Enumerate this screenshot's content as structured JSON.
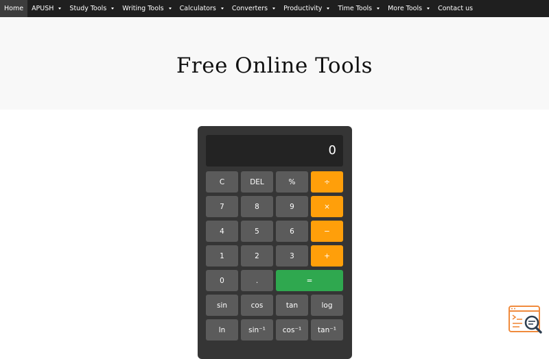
{
  "nav": {
    "items": [
      {
        "label": "Home",
        "dropdown": false,
        "active": true
      },
      {
        "label": "APUSH",
        "dropdown": true
      },
      {
        "label": "Study Tools",
        "dropdown": true
      },
      {
        "label": "Writing Tools",
        "dropdown": true
      },
      {
        "label": "Calculators",
        "dropdown": true
      },
      {
        "label": "Converters",
        "dropdown": true
      },
      {
        "label": "Productivity",
        "dropdown": true
      },
      {
        "label": "Time Tools",
        "dropdown": true
      },
      {
        "label": "More Tools",
        "dropdown": true
      },
      {
        "label": "Contact us",
        "dropdown": false
      }
    ]
  },
  "hero": {
    "title": "Free Online Tools"
  },
  "calculator": {
    "display": "0",
    "keys": {
      "clear": "C",
      "delete": "DEL",
      "percent": "%",
      "divide": "÷",
      "seven": "7",
      "eight": "8",
      "nine": "9",
      "multiply": "×",
      "four": "4",
      "five": "5",
      "six": "6",
      "subtract": "−",
      "one": "1",
      "two": "2",
      "three": "3",
      "add": "+",
      "zero": "0",
      "decimal": ".",
      "equals": "=",
      "sin": "sin",
      "cos": "cos",
      "tan": "tan",
      "log": "log",
      "ln": "ln",
      "asin": "sin⁻¹",
      "acos": "cos⁻¹",
      "atan": "tan⁻¹"
    }
  },
  "colors": {
    "nav_bg": "#1f1f1f",
    "hero_bg": "#f8f8f8",
    "calc_body": "#353535",
    "calc_display": "#232323",
    "key_default": "#5b5b5b",
    "key_operator": "#ff9f0a",
    "key_equals": "#2fa84f",
    "logo_accent": "#f08a3c",
    "logo_dark": "#2d3e50"
  },
  "icons": {
    "site_logo": "code-search-logo-icon"
  }
}
